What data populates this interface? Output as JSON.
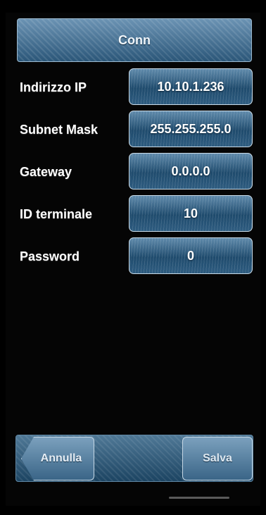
{
  "header": {
    "title": "Conn"
  },
  "fields": [
    {
      "label": "Indirizzo IP",
      "value": "10.10.1.236"
    },
    {
      "label": "Subnet Mask",
      "value": "255.255.255.0"
    },
    {
      "label": "Gateway",
      "value": "0.0.0.0"
    },
    {
      "label": "ID terminale",
      "value": "10"
    },
    {
      "label": "Password",
      "value": "0"
    }
  ],
  "footer": {
    "cancel_label": "Annulla",
    "save_label": "Salva"
  }
}
